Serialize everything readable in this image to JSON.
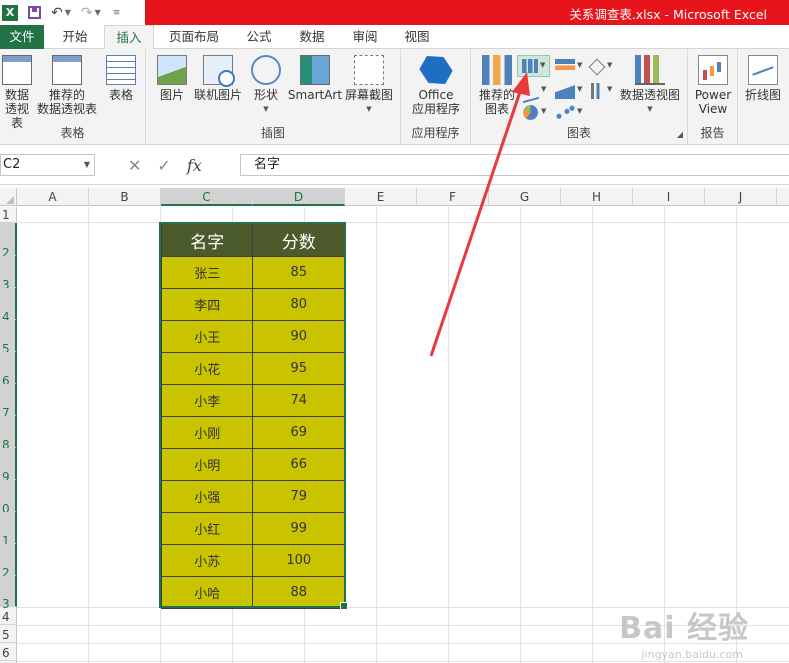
{
  "window": {
    "title": "关系调查表.xlsx -  Microsoft Excel",
    "accent": "#e8141b"
  },
  "qat": {
    "app_icon": "excel-icon",
    "items": [
      "save-icon",
      "undo-icon",
      "redo-icon",
      "customize-icon"
    ]
  },
  "tabs": [
    "文件",
    "开始",
    "插入",
    "页面布局",
    "公式",
    "数据",
    "审阅",
    "视图"
  ],
  "active_tab": "插入",
  "ribbon": {
    "groups": {
      "tables": "表格",
      "illustrations": "插图",
      "apps": "应用程序",
      "charts": "图表",
      "reports": "报告"
    },
    "buttons": {
      "pivot_line1": "数据",
      "pivot_line2": "透视表",
      "rec_pivot_line1": "推荐的",
      "rec_pivot_line2": "数据透视表",
      "table": "表格",
      "picture": "图片",
      "online_picture": "联机图片",
      "shapes": "形状",
      "smartart": "SmartArt",
      "screenshot": "屏幕截图",
      "office_line1": "Office",
      "office_line2": "应用程序",
      "rec_chart_line1": "推荐的",
      "rec_chart_line2": "图表",
      "pivot_chart": "数据透视图",
      "power_line1": "Power",
      "power_line2": "View",
      "sparkline": "折线图"
    }
  },
  "formula_bar": {
    "name_box": "C2",
    "formula": "名字"
  },
  "columns": [
    "A",
    "B",
    "C",
    "D",
    "E",
    "F",
    "G",
    "H",
    "I",
    "J"
  ],
  "rows": [
    "1",
    "2",
    "3",
    "4",
    "5",
    "6",
    "7",
    "8",
    "9",
    "0",
    "1",
    "2",
    "3",
    "4",
    "5",
    "6"
  ],
  "table": {
    "headers": [
      "名字",
      "分数"
    ],
    "rows": [
      [
        "张三",
        "85"
      ],
      [
        "李四",
        "80"
      ],
      [
        "小王",
        "90"
      ],
      [
        "小花",
        "95"
      ],
      [
        "小李",
        "74"
      ],
      [
        "小刚",
        "69"
      ],
      [
        "小明",
        "66"
      ],
      [
        "小强",
        "79"
      ],
      [
        "小红",
        "99"
      ],
      [
        "小苏",
        "100"
      ],
      [
        "小哈",
        "88"
      ]
    ],
    "header_color": "#4f5a2c",
    "cell_color": "#c9c300"
  },
  "annotation": {
    "arrow_color": "#e83a3a"
  },
  "watermark": {
    "brand": "Bai 经验",
    "url": "jingyan.baidu.com"
  }
}
